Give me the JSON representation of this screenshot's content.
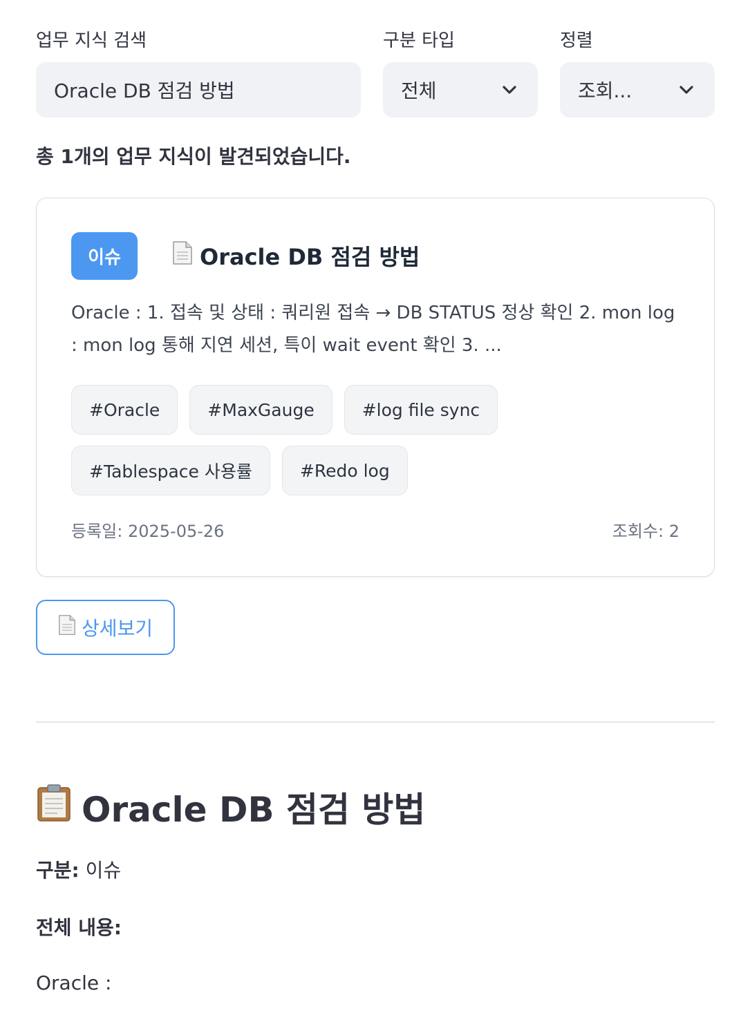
{
  "filters": {
    "search": {
      "label": "업무 지식 검색",
      "value": "Oracle DB 점검 방법"
    },
    "type": {
      "label": "구분 타입",
      "selected": "전체"
    },
    "sort": {
      "label": "정렬",
      "selected": "조회..."
    }
  },
  "summary": "총 1개의 업무 지식이 발견되었습니다.",
  "card": {
    "badge": "이슈",
    "title": "Oracle DB 점검 방법",
    "description": "Oracle : 1. 접속 및 상태 : 쿼리원 접속 → DB STATUS 정상 확인 2. mon log : mon log 통해 지연 세션, 특이 wait event 확인 3. ...",
    "tags": [
      "#Oracle",
      "#MaxGauge",
      "#log file sync",
      "#Tablespace 사용률",
      "#Redo log"
    ],
    "registered": "등록일: 2025-05-26",
    "views": "조회수: 2"
  },
  "detail_button": "상세보기",
  "detail": {
    "title": "Oracle DB 점검 방법",
    "category_label": "구분:",
    "category_value": "이슈",
    "content_label": "전체 내용:",
    "content_first_line": "Oracle :"
  },
  "colors": {
    "accent": "#4c97f0",
    "field_bg": "#f0f2f6",
    "text": "#31333f"
  },
  "icons": [
    "document-icon",
    "clipboard-icon",
    "chevron-down-icon"
  ]
}
